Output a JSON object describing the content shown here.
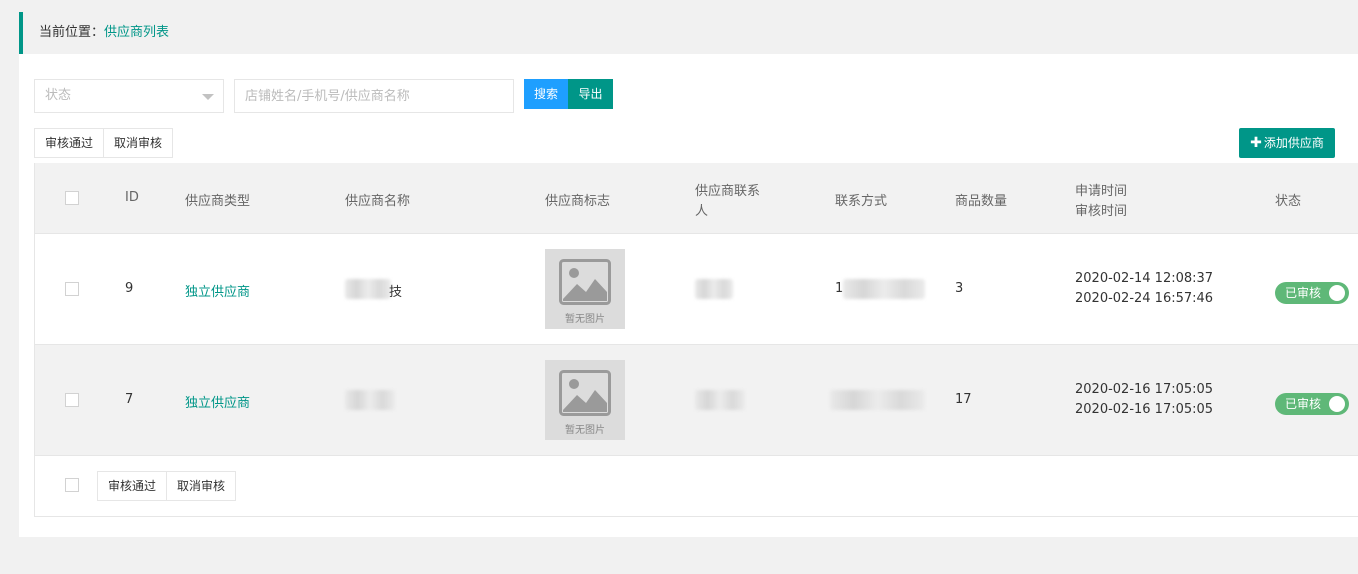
{
  "breadcrumb": {
    "prefix": "当前位置：",
    "current": "供应商列表"
  },
  "filters": {
    "status_placeholder": "状态",
    "search_placeholder": "店铺姓名/手机号/供应商名称",
    "search_label": "搜索",
    "export_label": "导出"
  },
  "actions": {
    "approve_label": "审核通过",
    "cancel_label": "取消审核",
    "add_label": "添加供应商"
  },
  "table": {
    "headers": {
      "id": "ID",
      "type": "供应商类型",
      "name": "供应商名称",
      "logo": "供应商标志",
      "contact_line1": "供应商联系",
      "contact_line2": "人",
      "phone": "联系方式",
      "count": "商品数量",
      "time_line1": "申请时间",
      "time_line2": "审核时间",
      "status": "状态"
    },
    "rows": [
      {
        "id": "9",
        "type": "独立供应商",
        "name_visible": "技",
        "logo_text": "暂无图片",
        "contact_visible": "",
        "phone_visible": "1",
        "count": "3",
        "apply_time": "2020-02-14 12:08:37",
        "audit_time": "2020-02-24 16:57:46",
        "status": "已审核"
      },
      {
        "id": "7",
        "type": "独立供应商",
        "name_visible": "",
        "logo_text": "暂无图片",
        "contact_visible": "",
        "phone_visible": "",
        "count": "17",
        "apply_time": "2020-02-16 17:05:05",
        "audit_time": "2020-02-16 17:05:05",
        "status": "已审核"
      }
    ]
  },
  "colors": {
    "accent": "#009688",
    "search": "#1e9fff",
    "status": "#5fb878"
  }
}
